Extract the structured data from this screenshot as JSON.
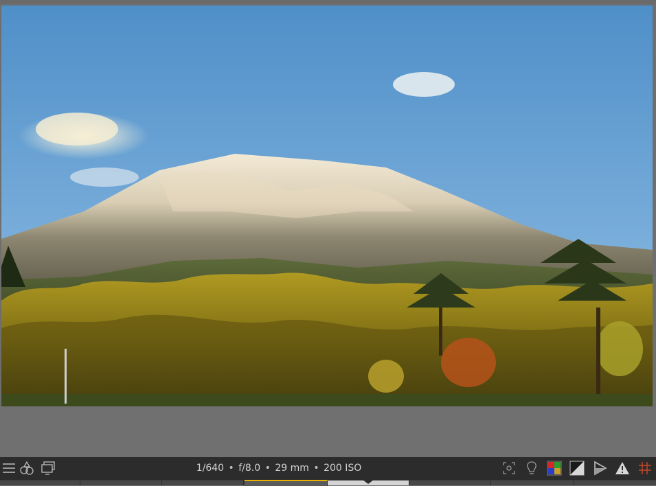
{
  "photo": {
    "subject": "mountain-landscape",
    "sky_color": "#6fa4d2",
    "foliage_color": "#a08a18"
  },
  "infobar": {
    "exif": {
      "shutter": "1/640",
      "aperture": "f/8.0",
      "focal_length": "29 mm",
      "iso": "200 ISO",
      "separator": "•"
    },
    "left_icons": [
      "menu-icon",
      "color-shapes-icon",
      "display-icon"
    ],
    "right_icons": [
      "focus-frame-icon",
      "lightbulb-icon",
      "color-channels-icon",
      "exposure-half-icon",
      "play-triangle-icon",
      "warning-icon",
      "grid-icon"
    ]
  },
  "colors": {
    "accent": "#e8b100",
    "bar_bg": "#2c2c2c",
    "workspace_bg": "#6e6e6e"
  },
  "filmstrip": {
    "thumb_count": 8,
    "active_index": 3,
    "hover_index": 4
  }
}
